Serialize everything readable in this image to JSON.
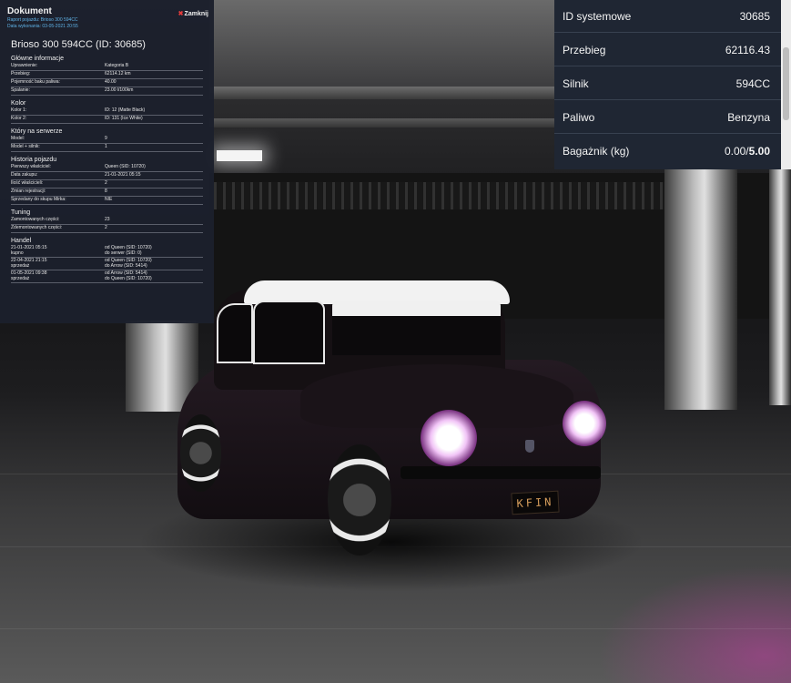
{
  "document": {
    "title": "Dokument",
    "report_line": "Raport pojazdu: Brioso 300 594CC",
    "date_line": "Data wykonania: 03-05-2021 20:55",
    "close_label": "Zamknij",
    "vehicle_heading": "Brioso 300 594CC (ID: 30685)",
    "sections": {
      "main_info": {
        "title": "Główne informacje",
        "rows": [
          {
            "key": "Uprawnienie:",
            "value": "Kategoria B"
          },
          {
            "key": "Przebieg:",
            "value": "62114.12 km"
          },
          {
            "key": "Pojemność baku paliwa:",
            "value": "40.00"
          },
          {
            "key": "Spalanie:",
            "value": "23.00 l/100km"
          }
        ]
      },
      "color": {
        "title": "Kolor",
        "rows": [
          {
            "key": "Kolor 1:",
            "value": "ID: 12 (Matte Black)"
          },
          {
            "key": "Kolor 2:",
            "value": "ID: 131 (Ice White)"
          }
        ]
      },
      "server": {
        "title": "Który na serwerze",
        "rows": [
          {
            "key": "Model:",
            "value": "9"
          },
          {
            "key": "Model + silnik:",
            "value": "1"
          }
        ]
      },
      "history": {
        "title": "Historia pojazdu",
        "rows": [
          {
            "key": "Pierwszy właściciel:",
            "value": "Queen (SID: 10720)"
          },
          {
            "key": "Data zakupu:",
            "value": "21-01-2021 05:15"
          },
          {
            "key": "Ilość właścicieli:",
            "value": "2"
          },
          {
            "key": "Zmian rejestracji:",
            "value": "8"
          },
          {
            "key": "Sprzedany do skupu Mirka:",
            "value": "NIE"
          }
        ]
      },
      "tuning": {
        "title": "Tuning",
        "rows": [
          {
            "key": "Zamontowanych części:",
            "value": "23"
          },
          {
            "key": "Zdemontowanych części:",
            "value": "2"
          }
        ]
      },
      "trade": {
        "title": "Handel",
        "rows": [
          {
            "key1": "21-01-2021 05:15",
            "key2": "kupno",
            "val1": "od Queen (SID: 10720)",
            "val2": "do serwer (SID: 0)"
          },
          {
            "key1": "22-04-2021 21:15",
            "key2": "sprzedaż",
            "val1": "od Queen (SID: 10720)",
            "val2": "do Arrow (SID: 5414)"
          },
          {
            "key1": "01-05-2021 09:38",
            "key2": "sprzedaż",
            "val1": "od Arrow (SID: 5414)",
            "val2": "do Queen (SID: 10720)"
          }
        ]
      }
    }
  },
  "stats": {
    "rows": [
      {
        "label": "ID systemowe",
        "value": "30685"
      },
      {
        "label": "Przebieg",
        "value": "62116.43"
      },
      {
        "label": "Silnik",
        "value": "594CC"
      },
      {
        "label": "Paliwo",
        "value": "Benzyna"
      }
    ],
    "trunk": {
      "label": "Bagażnik (kg)",
      "value_current": "0.00/",
      "value_max": "5.00"
    }
  },
  "scene": {
    "plate_text": "KFIN"
  }
}
